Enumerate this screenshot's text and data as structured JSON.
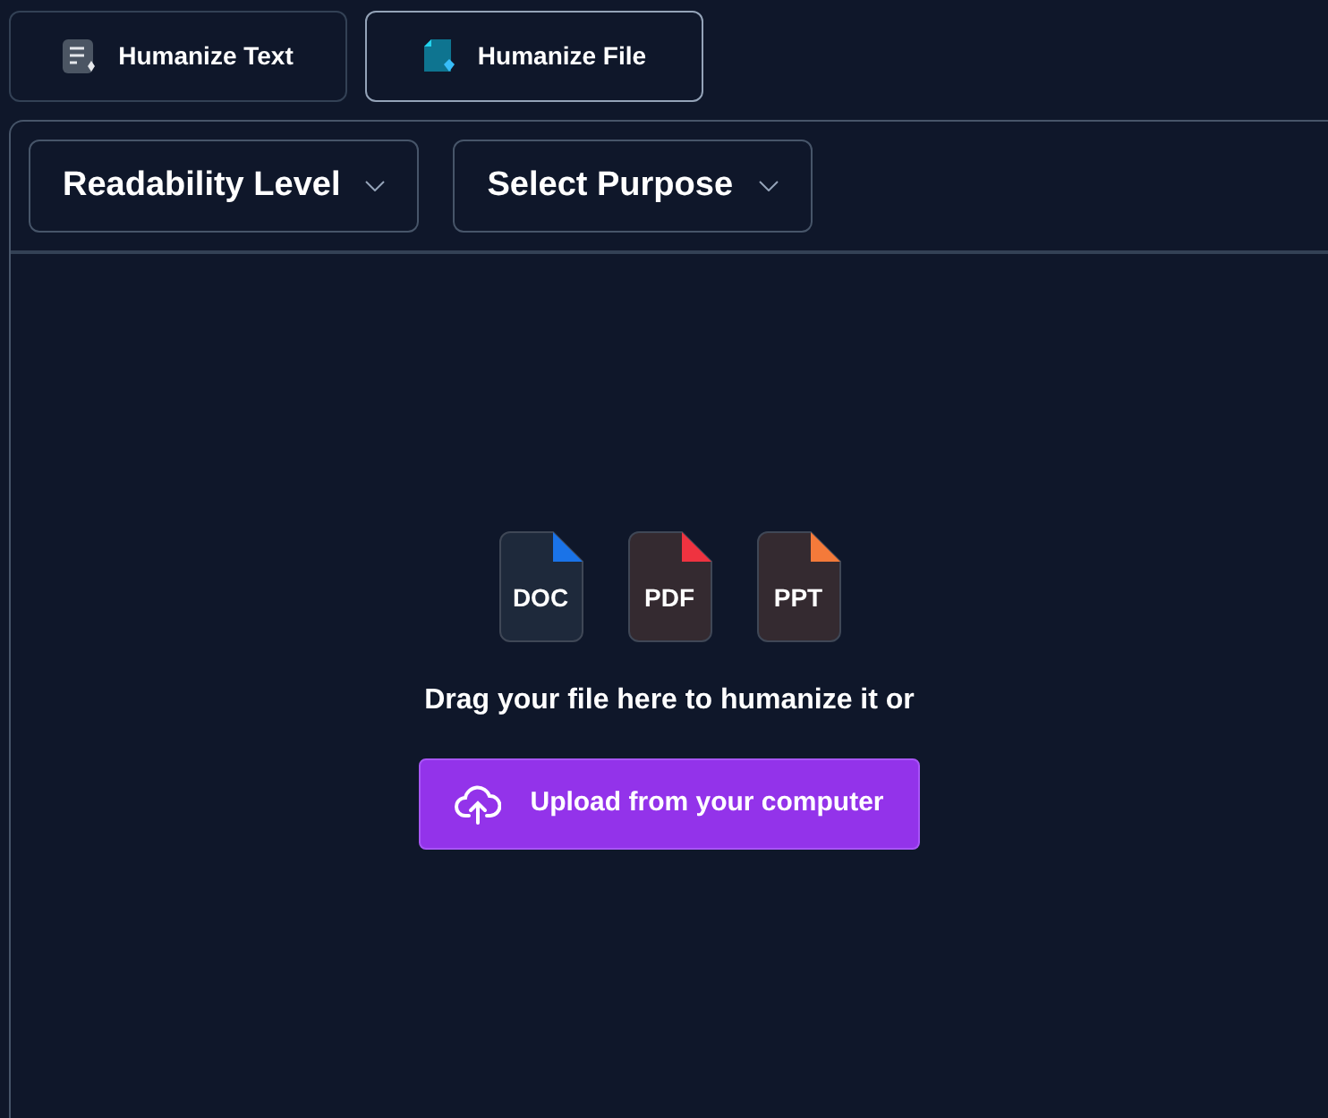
{
  "tabs": [
    {
      "label": "Humanize Text",
      "selected": false,
      "kind": "text"
    },
    {
      "label": "Humanize File",
      "selected": true,
      "kind": "file"
    }
  ],
  "dropdowns": [
    {
      "label": "Readability Level"
    },
    {
      "label": "Select Purpose"
    }
  ],
  "file_types": [
    {
      "label": "DOC",
      "color": "#1a73e8"
    },
    {
      "label": "PDF",
      "color": "#ef3340"
    },
    {
      "label": "PPT",
      "color": "#f47a3a"
    }
  ],
  "drop_prompt": "Drag your file here to humanize it or",
  "upload_button": "Upload from your computer"
}
